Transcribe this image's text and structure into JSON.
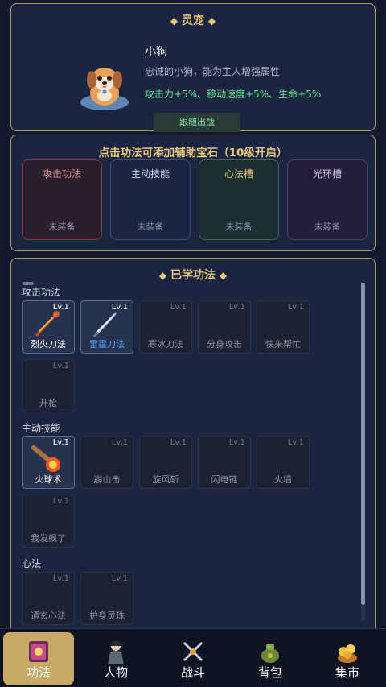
{
  "pet": {
    "title": "灵宠",
    "name": "小狗",
    "description": "忠诚的小狗，能为主人增强属性",
    "bonus": "攻击力+5%、移动速度+5%、生命+5%",
    "follow_button": "跟随出战"
  },
  "gems": {
    "title": "点击功法可添加辅助宝石（10级开启）",
    "slots": [
      {
        "name": "攻击功法",
        "state": "未装备",
        "color": "#d98a8a",
        "border": "#8a3a44",
        "bg": "#2a1e2c"
      },
      {
        "name": "主动技能",
        "state": "未装备",
        "color": "#c6d2f0",
        "border": "#3a4c80",
        "bg": "#1c2440"
      },
      {
        "name": "心法槽",
        "state": "未装备",
        "color": "#e6c87a",
        "border": "#3a6a56",
        "bg": "#1b2e30"
      },
      {
        "name": "光环槽",
        "state": "未装备",
        "color": "#d0c2ea",
        "border": "#5a3c7a",
        "bg": "#251e3a"
      }
    ]
  },
  "learned": {
    "title": "已学功法",
    "sections": [
      {
        "label": "攻击功法"
      },
      {
        "label": "主动技能"
      },
      {
        "label": "心法"
      }
    ],
    "attack": [
      {
        "lv": "Lv.1",
        "name": "烈火刀法",
        "learned": true,
        "name_color": "#ffffff"
      },
      {
        "lv": "Lv.1",
        "name": "雷霆刀法",
        "learned": true,
        "name_color": "#4aa6ff"
      },
      {
        "lv": "Lv.1",
        "name": "寒冰刀法",
        "learned": false
      },
      {
        "lv": "Lv.1",
        "name": "分身攻击",
        "learned": false
      },
      {
        "lv": "Lv.1",
        "name": "快来帮忙",
        "learned": false
      },
      {
        "lv": "Lv.1",
        "name": "开枪",
        "learned": false
      }
    ],
    "active": [
      {
        "lv": "Lv.1",
        "name": "火球术",
        "learned": true
      },
      {
        "lv": "Lv.1",
        "name": "崩山击",
        "learned": false
      },
      {
        "lv": "Lv.1",
        "name": "旋风斩",
        "learned": false
      },
      {
        "lv": "Lv.1",
        "name": "闪电链",
        "learned": false
      },
      {
        "lv": "Lv.1",
        "name": "火墙",
        "learned": false
      },
      {
        "lv": "Lv.1",
        "name": "我发飙了",
        "learned": false
      }
    ],
    "heart": [
      {
        "lv": "Lv.1",
        "name": "通玄心法",
        "learned": false
      },
      {
        "lv": "Lv.1",
        "name": "护身灵珠",
        "learned": false
      }
    ]
  },
  "nav": [
    {
      "label": "功法",
      "icon": "skill-book-icon",
      "active": true
    },
    {
      "label": "人物",
      "icon": "character-icon",
      "active": false
    },
    {
      "label": "战斗",
      "icon": "crossed-swords-icon",
      "active": false
    },
    {
      "label": "背包",
      "icon": "bag-icon",
      "active": false
    },
    {
      "label": "集市",
      "icon": "market-icon",
      "active": false
    }
  ]
}
